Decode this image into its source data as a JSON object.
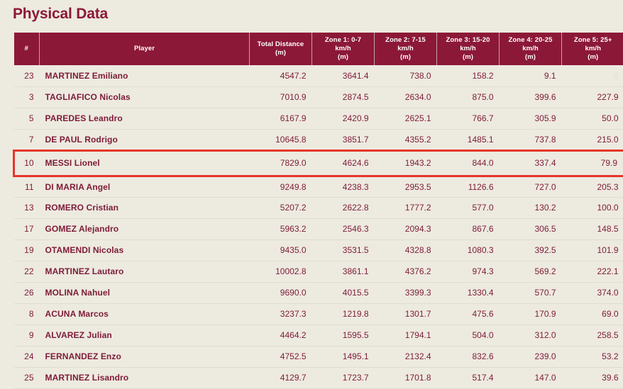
{
  "page": {
    "title": "Physical Data",
    "background_color": "#edeae0",
    "accent_color": "#8c1838",
    "highlight_color": "#e8352a"
  },
  "table": {
    "columns": [
      {
        "key": "number",
        "label_line1": "#",
        "label_line2": "",
        "align": "center"
      },
      {
        "key": "player",
        "label_line1": "Player",
        "label_line2": "",
        "align": "left"
      },
      {
        "key": "total_distance",
        "label_line1": "Total Distance",
        "label_line2": "(m)",
        "align": "right"
      },
      {
        "key": "zone1",
        "label_line1": "Zone 1: 0-7 km/h",
        "label_line2": "(m)",
        "align": "right"
      },
      {
        "key": "zone2",
        "label_line1": "Zone 2: 7-15 km/h",
        "label_line2": "(m)",
        "align": "right"
      },
      {
        "key": "zone3",
        "label_line1": "Zone 3: 15-20 km/h",
        "label_line2": "(m)",
        "align": "right"
      },
      {
        "key": "zone4",
        "label_line1": "Zone 4: 20-25 km/h",
        "label_line2": "(m)",
        "align": "right"
      },
      {
        "key": "zone5",
        "label_line1": "Zone 5: 25+ km/h",
        "label_line2": "(m)",
        "align": "right"
      }
    ],
    "rows": [
      {
        "number": "23",
        "player": "MARTINEZ Emiliano",
        "total_distance": "4547.2",
        "zone1": "3641.4",
        "zone2": "738.0",
        "zone3": "158.2",
        "zone4": "9.1",
        "zone5": "0",
        "zone5_faded": true,
        "highlighted": false
      },
      {
        "number": "3",
        "player": "TAGLIAFICO Nicolas",
        "total_distance": "7010.9",
        "zone1": "2874.5",
        "zone2": "2634.0",
        "zone3": "875.0",
        "zone4": "399.6",
        "zone5": "227.9",
        "zone5_faded": false,
        "highlighted": false
      },
      {
        "number": "5",
        "player": "PAREDES Leandro",
        "total_distance": "6167.9",
        "zone1": "2420.9",
        "zone2": "2625.1",
        "zone3": "766.7",
        "zone4": "305.9",
        "zone5": "50.0",
        "zone5_faded": false,
        "highlighted": false
      },
      {
        "number": "7",
        "player": "DE PAUL Rodrigo",
        "total_distance": "10645.8",
        "zone1": "3851.7",
        "zone2": "4355.2",
        "zone3": "1485.1",
        "zone4": "737.8",
        "zone5": "215.0",
        "zone5_faded": false,
        "highlighted": false
      },
      {
        "number": "10",
        "player": "MESSI Lionel",
        "total_distance": "7829.0",
        "zone1": "4624.6",
        "zone2": "1943.2",
        "zone3": "844.0",
        "zone4": "337.4",
        "zone5": "79.9",
        "zone5_faded": false,
        "highlighted": true
      },
      {
        "number": "11",
        "player": "DI MARIA Angel",
        "total_distance": "9249.8",
        "zone1": "4238.3",
        "zone2": "2953.5",
        "zone3": "1126.6",
        "zone4": "727.0",
        "zone5": "205.3",
        "zone5_faded": false,
        "highlighted": false
      },
      {
        "number": "13",
        "player": "ROMERO Cristian",
        "total_distance": "5207.2",
        "zone1": "2622.8",
        "zone2": "1777.2",
        "zone3": "577.0",
        "zone4": "130.2",
        "zone5": "100.0",
        "zone5_faded": false,
        "highlighted": false
      },
      {
        "number": "17",
        "player": "GOMEZ Alejandro",
        "total_distance": "5963.2",
        "zone1": "2546.3",
        "zone2": "2094.3",
        "zone3": "867.6",
        "zone4": "306.5",
        "zone5": "148.5",
        "zone5_faded": false,
        "highlighted": false
      },
      {
        "number": "19",
        "player": "OTAMENDI Nicolas",
        "total_distance": "9435.0",
        "zone1": "3531.5",
        "zone2": "4328.8",
        "zone3": "1080.3",
        "zone4": "392.5",
        "zone5": "101.9",
        "zone5_faded": false,
        "highlighted": false
      },
      {
        "number": "22",
        "player": "MARTINEZ Lautaro",
        "total_distance": "10002.8",
        "zone1": "3861.1",
        "zone2": "4376.2",
        "zone3": "974.3",
        "zone4": "569.2",
        "zone5": "222.1",
        "zone5_faded": false,
        "highlighted": false
      },
      {
        "number": "26",
        "player": "MOLINA Nahuel",
        "total_distance": "9690.0",
        "zone1": "4015.5",
        "zone2": "3399.3",
        "zone3": "1330.4",
        "zone4": "570.7",
        "zone5": "374.0",
        "zone5_faded": false,
        "highlighted": false
      },
      {
        "number": "8",
        "player": "ACUNA Marcos",
        "total_distance": "3237.3",
        "zone1": "1219.8",
        "zone2": "1301.7",
        "zone3": "475.6",
        "zone4": "170.9",
        "zone5": "69.0",
        "zone5_faded": false,
        "highlighted": false
      },
      {
        "number": "9",
        "player": "ALVAREZ Julian",
        "total_distance": "4464.2",
        "zone1": "1595.5",
        "zone2": "1794.1",
        "zone3": "504.0",
        "zone4": "312.0",
        "zone5": "258.5",
        "zone5_faded": false,
        "highlighted": false
      },
      {
        "number": "24",
        "player": "FERNANDEZ Enzo",
        "total_distance": "4752.5",
        "zone1": "1495.1",
        "zone2": "2132.4",
        "zone3": "832.6",
        "zone4": "239.0",
        "zone5": "53.2",
        "zone5_faded": false,
        "highlighted": false
      },
      {
        "number": "25",
        "player": "MARTINEZ Lisandro",
        "total_distance": "4129.7",
        "zone1": "1723.7",
        "zone2": "1701.8",
        "zone3": "517.4",
        "zone4": "147.0",
        "zone5": "39.6",
        "zone5_faded": false,
        "highlighted": false
      }
    ]
  }
}
